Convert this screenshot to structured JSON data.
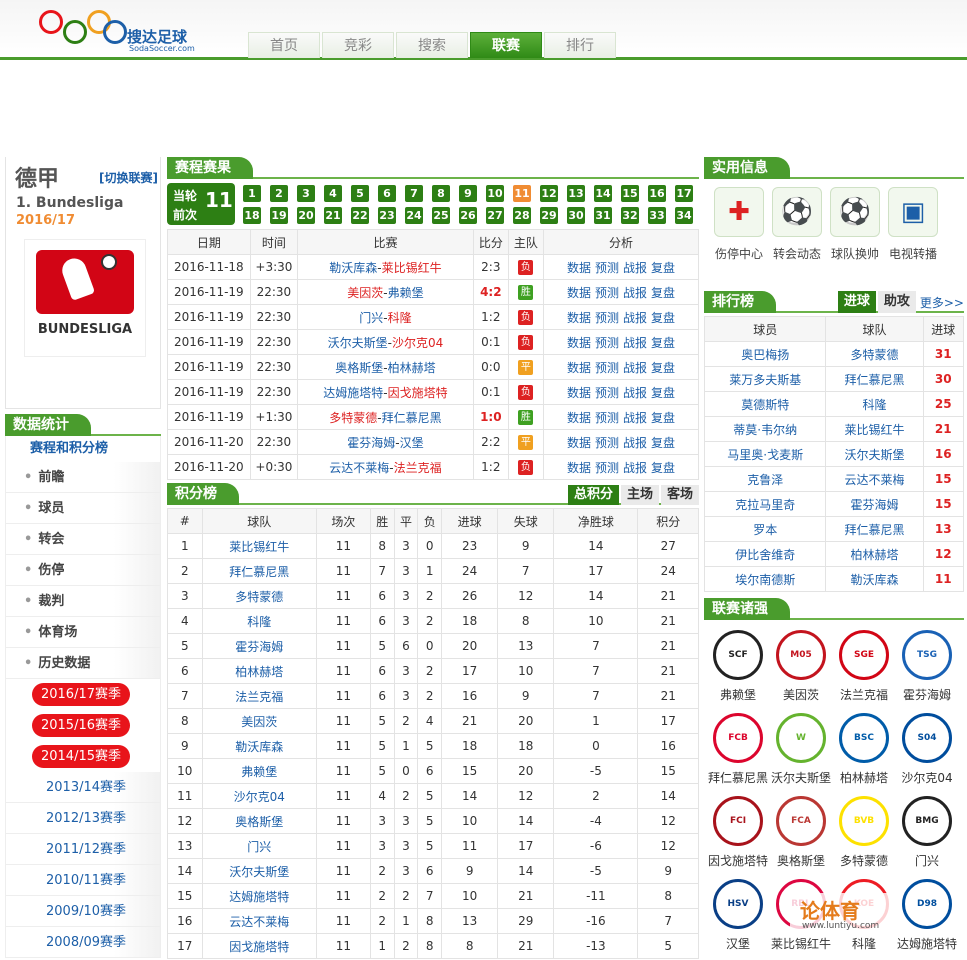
{
  "header": {
    "logo_text": "搜达足球",
    "logo_sub": "SodaSoccer.com",
    "nav": [
      "首页",
      "竞彩",
      "搜索",
      "联赛",
      "排行"
    ],
    "nav_active": 3
  },
  "league": {
    "name": "德甲",
    "switch": "[切换联赛]",
    "sub": "1. Bundesliga",
    "season": "2016/17",
    "logo_text": "BUNDESLIGA"
  },
  "stats": {
    "title": "数据统计",
    "main": "赛程和积分榜",
    "items": [
      "前瞻",
      "球员",
      "转会",
      "伤停",
      "裁判",
      "体育场",
      "历史数据"
    ],
    "seasons_red": [
      "2016/17赛季",
      "2015/16赛季",
      "2014/15赛季"
    ],
    "seasons": [
      "2013/14赛季",
      "2012/13赛季",
      "2011/12赛季",
      "2010/11赛季",
      "2009/10赛季",
      "2008/09赛季"
    ]
  },
  "fixtures": {
    "title": "赛程赛果",
    "current_label1": "当轮",
    "current_label2": "前次",
    "current_round": "11",
    "rounds": [
      "1",
      "2",
      "3",
      "4",
      "5",
      "6",
      "7",
      "8",
      "9",
      "10",
      "11",
      "12",
      "13",
      "14",
      "15",
      "16",
      "17",
      "18",
      "19",
      "20",
      "21",
      "22",
      "23",
      "24",
      "25",
      "26",
      "27",
      "28",
      "29",
      "30",
      "31",
      "32",
      "33",
      "34"
    ],
    "headers": [
      "日期",
      "时间",
      "比赛",
      "比分",
      "主队",
      "分析"
    ],
    "rows": [
      {
        "date": "2016-11-18",
        "time": "+3:30",
        "home": "勒沃库森",
        "away": "莱比锡红牛",
        "winner": "away",
        "score": "2:3",
        "hl": false,
        "res": "负"
      },
      {
        "date": "2016-11-19",
        "time": "22:30",
        "home": "美因茨",
        "away": "弗赖堡",
        "winner": "home",
        "score": "4:2",
        "hl": true,
        "res": "胜"
      },
      {
        "date": "2016-11-19",
        "time": "22:30",
        "home": "门兴",
        "away": "科隆",
        "winner": "away",
        "score": "1:2",
        "hl": false,
        "res": "负"
      },
      {
        "date": "2016-11-19",
        "time": "22:30",
        "home": "沃尔夫斯堡",
        "away": "沙尔克04",
        "winner": "away",
        "score": "0:1",
        "hl": false,
        "res": "负"
      },
      {
        "date": "2016-11-19",
        "time": "22:30",
        "home": "奥格斯堡",
        "away": "柏林赫塔",
        "winner": "none",
        "score": "0:0",
        "hl": false,
        "res": "平"
      },
      {
        "date": "2016-11-19",
        "time": "22:30",
        "home": "达姆施塔特",
        "away": "因戈施塔特",
        "winner": "away",
        "score": "0:1",
        "hl": false,
        "res": "负"
      },
      {
        "date": "2016-11-19",
        "time": "+1:30",
        "home": "多特蒙德",
        "away": "拜仁慕尼黑",
        "winner": "home",
        "score": "1:0",
        "hl": true,
        "res": "胜"
      },
      {
        "date": "2016-11-20",
        "time": "22:30",
        "home": "霍芬海姆",
        "away": "汉堡",
        "winner": "none",
        "score": "2:2",
        "hl": false,
        "res": "平"
      },
      {
        "date": "2016-11-20",
        "time": "+0:30",
        "home": "云达不莱梅",
        "away": "法兰克福",
        "winner": "away",
        "score": "1:2",
        "hl": false,
        "res": "负"
      }
    ],
    "links": [
      "数据",
      "预测",
      "战报",
      "复盘"
    ]
  },
  "standings": {
    "title": "积分榜",
    "tabs": [
      "总积分",
      "主场",
      "客场"
    ],
    "headers": [
      "#",
      "球队",
      "场次",
      "胜",
      "平",
      "负",
      "进球",
      "失球",
      "净胜球",
      "积分"
    ],
    "rows": [
      [
        "1",
        "莱比锡红牛",
        "11",
        "8",
        "3",
        "0",
        "23",
        "9",
        "14",
        "27"
      ],
      [
        "2",
        "拜仁慕尼黑",
        "11",
        "7",
        "3",
        "1",
        "24",
        "7",
        "17",
        "24"
      ],
      [
        "3",
        "多特蒙德",
        "11",
        "6",
        "3",
        "2",
        "26",
        "12",
        "14",
        "21"
      ],
      [
        "4",
        "科隆",
        "11",
        "6",
        "3",
        "2",
        "18",
        "8",
        "10",
        "21"
      ],
      [
        "5",
        "霍芬海姆",
        "11",
        "5",
        "6",
        "0",
        "20",
        "13",
        "7",
        "21"
      ],
      [
        "6",
        "柏林赫塔",
        "11",
        "6",
        "3",
        "2",
        "17",
        "10",
        "7",
        "21"
      ],
      [
        "7",
        "法兰克福",
        "11",
        "6",
        "3",
        "2",
        "16",
        "9",
        "7",
        "21"
      ],
      [
        "8",
        "美因茨",
        "11",
        "5",
        "2",
        "4",
        "21",
        "20",
        "1",
        "17"
      ],
      [
        "9",
        "勒沃库森",
        "11",
        "5",
        "1",
        "5",
        "18",
        "18",
        "0",
        "16"
      ],
      [
        "10",
        "弗赖堡",
        "11",
        "5",
        "0",
        "6",
        "15",
        "20",
        "-5",
        "15"
      ],
      [
        "11",
        "沙尔克04",
        "11",
        "4",
        "2",
        "5",
        "14",
        "12",
        "2",
        "14"
      ],
      [
        "12",
        "奥格斯堡",
        "11",
        "3",
        "3",
        "5",
        "10",
        "14",
        "-4",
        "12"
      ],
      [
        "13",
        "门兴",
        "11",
        "3",
        "3",
        "5",
        "11",
        "17",
        "-6",
        "12"
      ],
      [
        "14",
        "沃尔夫斯堡",
        "11",
        "2",
        "3",
        "6",
        "9",
        "14",
        "-5",
        "9"
      ],
      [
        "15",
        "达姆施塔特",
        "11",
        "2",
        "2",
        "7",
        "10",
        "21",
        "-11",
        "8"
      ],
      [
        "16",
        "云达不莱梅",
        "11",
        "2",
        "1",
        "8",
        "13",
        "29",
        "-16",
        "7"
      ],
      [
        "17",
        "因戈施塔特",
        "11",
        "1",
        "2",
        "8",
        "8",
        "21",
        "-13",
        "5"
      ]
    ]
  },
  "tools": {
    "title": "实用信息",
    "items": [
      {
        "label": "伤停中心",
        "icon": "medkit-icon"
      },
      {
        "label": "转会动态",
        "icon": "transfer-icon"
      },
      {
        "label": "球队换帅",
        "icon": "coach-icon"
      },
      {
        "label": "电视转播",
        "icon": "tv-icon"
      }
    ]
  },
  "scorers": {
    "title": "排行榜",
    "tabs": [
      "进球",
      "助攻"
    ],
    "more": "更多>>",
    "headers": [
      "球员",
      "球队",
      "进球"
    ],
    "rows": [
      [
        "奥巴梅扬",
        "多特蒙德",
        "31"
      ],
      [
        "莱万多夫斯基",
        "拜仁慕尼黑",
        "30"
      ],
      [
        "莫德斯特",
        "科隆",
        "25"
      ],
      [
        "蒂莫·韦尔纳",
        "莱比锡红牛",
        "21"
      ],
      [
        "马里奥·戈麦斯",
        "沃尔夫斯堡",
        "16"
      ],
      [
        "克鲁泽",
        "云达不莱梅",
        "15"
      ],
      [
        "克拉马里奇",
        "霍芬海姆",
        "15"
      ],
      [
        "罗本",
        "拜仁慕尼黑",
        "13"
      ],
      [
        "伊比舍维奇",
        "柏林赫塔",
        "12"
      ],
      [
        "埃尔南德斯",
        "勒沃库森",
        "11"
      ]
    ]
  },
  "clubs": {
    "title": "联赛诸强",
    "items": [
      {
        "name": "弗赖堡",
        "color": "#222222",
        "abbr": "SCF"
      },
      {
        "name": "美因茨",
        "color": "#c3141e",
        "abbr": "M05"
      },
      {
        "name": "法兰克福",
        "color": "#d20515",
        "abbr": "SGE"
      },
      {
        "name": "霍芬海姆",
        "color": "#1961b5",
        "abbr": "TSG"
      },
      {
        "name": "拜仁慕尼黑",
        "color": "#dc052d",
        "abbr": "FCB"
      },
      {
        "name": "沃尔夫斯堡",
        "color": "#65b32e",
        "abbr": "W"
      },
      {
        "name": "柏林赫塔",
        "color": "#005ca9",
        "abbr": "BSC"
      },
      {
        "name": "沙尔克04",
        "color": "#004d9d",
        "abbr": "S04"
      },
      {
        "name": "因戈施塔特",
        "color": "#a8121b",
        "abbr": "FCI"
      },
      {
        "name": "奥格斯堡",
        "color": "#ba3733",
        "abbr": "FCA"
      },
      {
        "name": "多特蒙德",
        "color": "#fde100",
        "abbr": "BVB"
      },
      {
        "name": "门兴",
        "color": "#222222",
        "abbr": "BMG"
      },
      {
        "name": "汉堡",
        "color": "#0a3f86",
        "abbr": "HSV"
      },
      {
        "name": "莱比锡红牛",
        "color": "#dd0741",
        "abbr": "RBL"
      },
      {
        "name": "科隆",
        "color": "#ed1c24",
        "abbr": "KOE"
      },
      {
        "name": "达姆施塔特",
        "color": "#004e9e",
        "abbr": "D98"
      }
    ]
  },
  "watermark": {
    "t1": "论体育",
    "t2": "www.luntiyu.com"
  }
}
